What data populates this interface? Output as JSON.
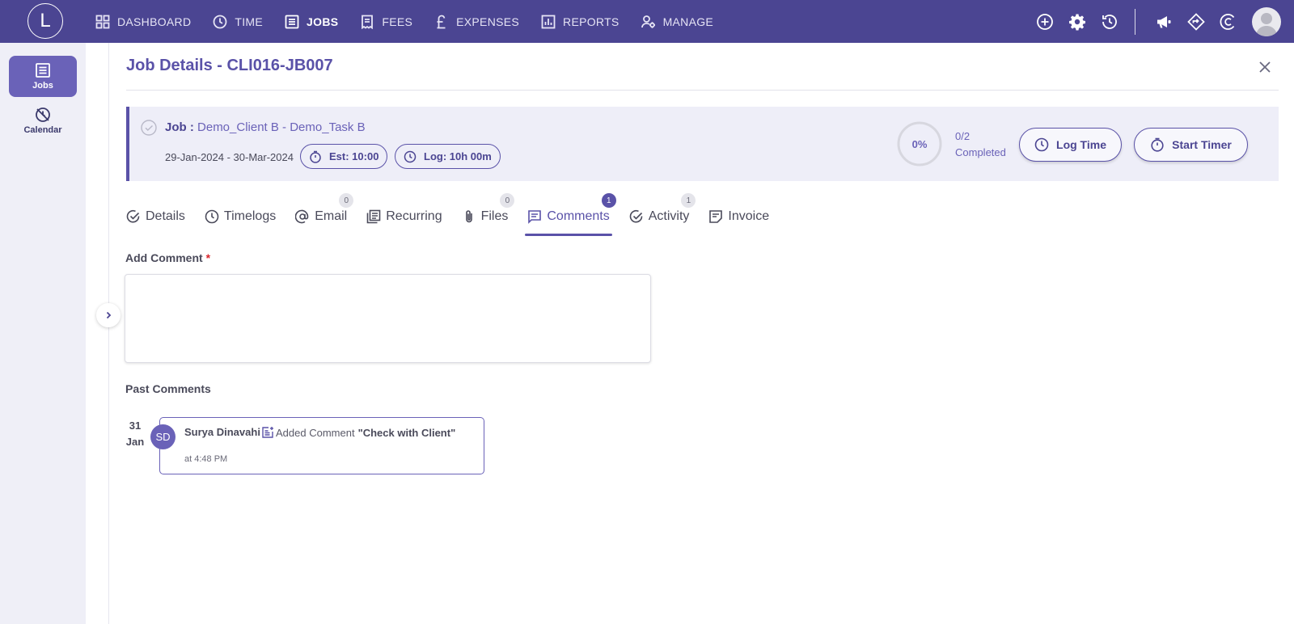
{
  "app": {
    "logo_letter": "L"
  },
  "nav": {
    "items": [
      {
        "label": "DASHBOARD",
        "icon": "dashboard-grid-icon"
      },
      {
        "label": "TIME",
        "icon": "clock-icon"
      },
      {
        "label": "JOBS",
        "icon": "list-icon",
        "active": true
      },
      {
        "label": "FEES",
        "icon": "receipt-icon"
      },
      {
        "label": "EXPENSES",
        "icon": "pound-icon"
      },
      {
        "label": "REPORTS",
        "icon": "chart-icon"
      },
      {
        "label": "MANAGE",
        "icon": "manage-users-icon"
      }
    ]
  },
  "sidebar": {
    "items": [
      {
        "label": "Jobs",
        "icon": "jobs-list-icon",
        "active": true
      },
      {
        "label": "Calendar",
        "icon": "calendar-off-icon"
      }
    ]
  },
  "page": {
    "title": "Job Details - CLI016-JB007"
  },
  "job": {
    "label": "Job :",
    "name": "Demo_Client B - Demo_Task B",
    "dates": "29-Jan-2024 - 30-Mar-2024",
    "estimate": "Est: 10:00",
    "logged": "Log: 10h 00m",
    "progress_percent": 0,
    "progress_label": "0%",
    "completed_count": "0/2",
    "completed_label": "Completed",
    "log_time_label": "Log Time",
    "start_timer_label": "Start Timer"
  },
  "tabs": [
    {
      "label": "Details",
      "badge": ""
    },
    {
      "label": "Timelogs",
      "badge": ""
    },
    {
      "label": "Email",
      "badge": "0"
    },
    {
      "label": "Recurring",
      "badge": ""
    },
    {
      "label": "Files",
      "badge": "0"
    },
    {
      "label": "Comments",
      "badge": "1",
      "active": true
    },
    {
      "label": "Activity",
      "badge": "1"
    },
    {
      "label": "Invoice",
      "badge": ""
    }
  ],
  "comment_form": {
    "label": "Add Comment",
    "required_mark": "*",
    "value": ""
  },
  "past_comments": {
    "label": "Past Comments",
    "items": [
      {
        "day": "31",
        "month": "Jan",
        "initials": "SD",
        "author": "Surya Dinavahi",
        "action": "Added Comment",
        "text": "\"Check with Client\"",
        "time": "at 4:48 PM"
      }
    ]
  },
  "colors": {
    "brand": "#4b4592",
    "accent": "#5a52a8",
    "panel": "#eeeef8"
  }
}
